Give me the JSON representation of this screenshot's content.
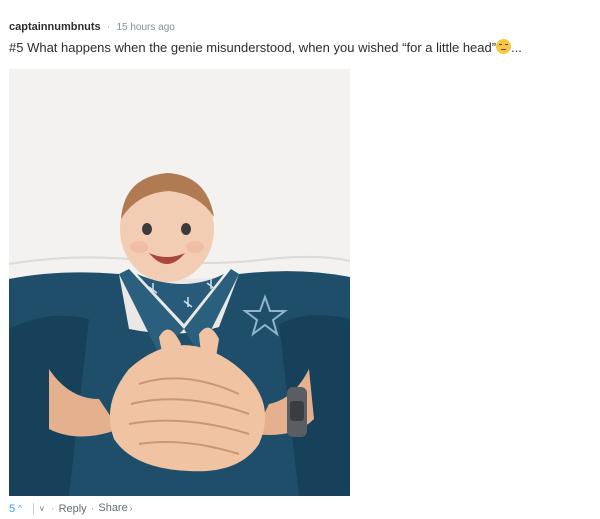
{
  "comment": {
    "username": "captainnumbnuts",
    "separator": "·",
    "timestamp": "15 hours ago",
    "text": "#5 What happens when the genie misunderstood, when you wished “for a little head”",
    "trailing": "...",
    "image_alt": "Photo of a smiling baby in a blue robe lying on pillows, arranged so the baby's head appears atop an adult's body with hands clasped"
  },
  "footer": {
    "votes": "5",
    "upvote_icon": "^",
    "downvote_icon": "v",
    "reply_label": "Reply",
    "share_label": "Share",
    "share_chevron": "›",
    "bullet": "·"
  }
}
